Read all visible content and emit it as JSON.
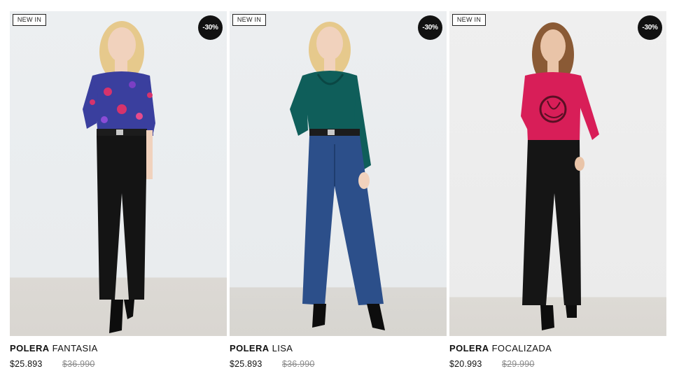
{
  "products": [
    {
      "badge_new": "NEW IN",
      "badge_discount": "-30%",
      "name_bold": "POLERA",
      "name_rest": "FANTASIA",
      "price": "$25.893",
      "old_price": "$36.990",
      "colors": {
        "top": "#3a3f9e",
        "top_accent": "#d6336c",
        "pants": "#141414",
        "hair": "#e6c98c"
      }
    },
    {
      "badge_new": "NEW IN",
      "badge_discount": "-30%",
      "name_bold": "POLERA",
      "name_rest": "LISA",
      "price": "$25.893",
      "old_price": "$36.990",
      "colors": {
        "top": "#0f5e5a",
        "pants": "#2c4f8a",
        "hair": "#e6c98c"
      }
    },
    {
      "badge_new": "NEW IN",
      "badge_discount": "-30%",
      "name_bold": "POLERA",
      "name_rest": "FOCALIZADA",
      "price": "$20.993",
      "old_price": "$29.990",
      "colors": {
        "top": "#d81e58",
        "pants": "#151515",
        "hair": "#8a5a35"
      }
    }
  ]
}
